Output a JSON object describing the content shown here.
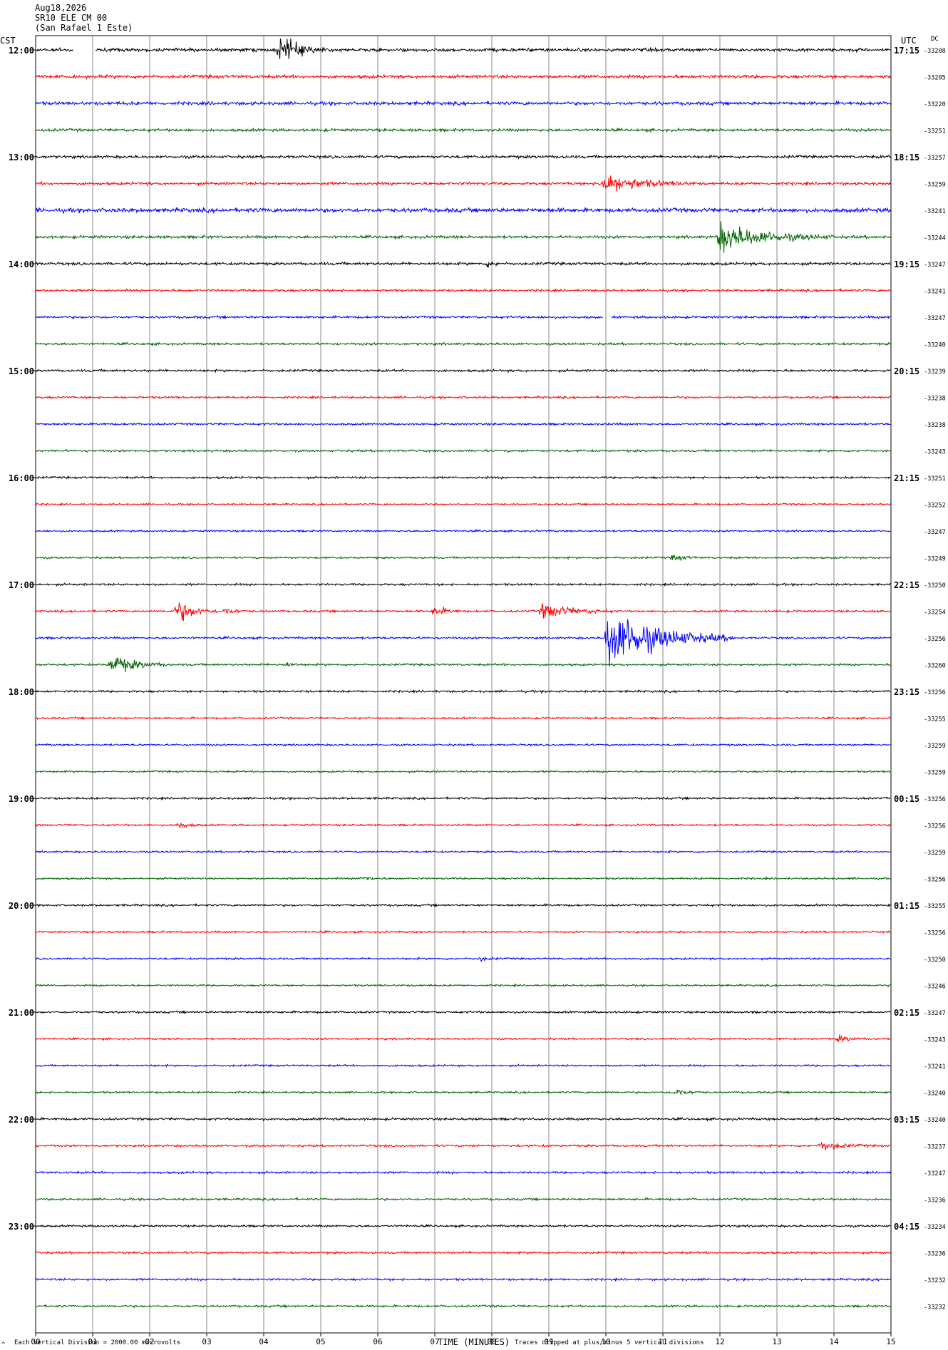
{
  "header": {
    "date": "Aug18,2026",
    "station": "SR10 ELE CM 00",
    "site": "(San Rafael 1 Este)"
  },
  "axes": {
    "left_tz": "CST",
    "right_tz": "UTC",
    "dc_label": "DC",
    "xlabel": "TIME (MINUTES)",
    "x_ticks": [
      "00",
      "01",
      "02",
      "03",
      "04",
      "05",
      "06",
      "07",
      "08",
      "09",
      "10",
      "11",
      "12",
      "13",
      "14",
      "15"
    ]
  },
  "footer": {
    "scale_note": "Each Vertical Division = 2000.00 microvolts",
    "clip_note": "Traces clipped at plus/minus 5 vertical divisions",
    "corner_mark": "^"
  },
  "colors": [
    "#000000",
    "#ff0000",
    "#0000ff",
    "#006400"
  ],
  "chart_data": {
    "type": "line",
    "description_kind": "helicorder",
    "minutes_per_line": 15,
    "x_range": [
      0,
      15
    ],
    "left_hour_labels": [
      "12:00",
      "13:00",
      "14:00",
      "15:00",
      "16:00",
      "17:00",
      "18:00",
      "19:00",
      "20:00",
      "21:00",
      "22:00",
      "23:00"
    ],
    "right_hour_labels": [
      "17:15",
      "18:15",
      "19:15",
      "20:15",
      "21:15",
      "22:15",
      "23:15",
      "00:15",
      "01:15",
      "02:15",
      "03:15",
      "04:15"
    ],
    "dc_offsets": [
      "-33208",
      "-33205",
      "-33220",
      "-33251",
      "-33257",
      "-33259",
      "-33241",
      "-33244",
      "-33247",
      "-33241",
      "-33247",
      "-33240",
      "-33239",
      "-33238",
      "-33238",
      "-33243",
      "-33251",
      "-33252",
      "-33247",
      "-33249",
      "-33250",
      "-33254",
      "-33256",
      "-33260",
      "-33256",
      "-33255",
      "-33259",
      "-33259",
      "-33256",
      "-33256",
      "-33259",
      "-33256",
      "-33255",
      "-33256",
      "-33250",
      "-33246",
      "-33247",
      "-33243",
      "-33241",
      "-33240",
      "-33240",
      "-33237",
      "-33247",
      "-33236",
      "-33234",
      "-33236",
      "-33232",
      "-33232"
    ],
    "noise_level": [
      0.7,
      0.7,
      0.7,
      0.6,
      0.6,
      0.6,
      0.9,
      0.6,
      0.6,
      0.5,
      0.5,
      0.5,
      0.5,
      0.45,
      0.45,
      0.45,
      0.45,
      0.4,
      0.4,
      0.4,
      0.45,
      0.45,
      0.45,
      0.45,
      0.45,
      0.4,
      0.4,
      0.4,
      0.45,
      0.4,
      0.4,
      0.4,
      0.45,
      0.4,
      0.4,
      0.4,
      0.45,
      0.4,
      0.4,
      0.4,
      0.5,
      0.45,
      0.45,
      0.45,
      0.45,
      0.45,
      0.45,
      0.45
    ],
    "events": [
      {
        "line": 0,
        "minute": 4.3,
        "amp": 14,
        "dur": 0.8
      },
      {
        "line": 5,
        "minute": 9.95,
        "amp": 10,
        "dur": 1.6
      },
      {
        "line": 7,
        "minute": 12.0,
        "amp": 14,
        "dur": 2.0
      },
      {
        "line": 8,
        "minute": 7.95,
        "amp": 3,
        "dur": 0.3
      },
      {
        "line": 19,
        "minute": 11.2,
        "amp": 3,
        "dur": 0.5
      },
      {
        "line": 21,
        "minute": 2.5,
        "amp": 11,
        "dur": 0.7
      },
      {
        "line": 21,
        "minute": 3.35,
        "amp": 3,
        "dur": 0.4
      },
      {
        "line": 21,
        "minute": 7.0,
        "amp": 5,
        "dur": 0.5
      },
      {
        "line": 21,
        "minute": 8.9,
        "amp": 8,
        "dur": 1.2
      },
      {
        "line": 22,
        "minute": 10.05,
        "amp": 30,
        "dur": 2.2
      },
      {
        "line": 23,
        "minute": 1.35,
        "amp": 10,
        "dur": 1.0
      },
      {
        "line": 23,
        "minute": 4.4,
        "amp": 2,
        "dur": 0.3
      },
      {
        "line": 29,
        "minute": 2.5,
        "amp": 3,
        "dur": 0.5
      },
      {
        "line": 31,
        "minute": 5.7,
        "amp": 2,
        "dur": 0.4
      },
      {
        "line": 34,
        "minute": 7.8,
        "amp": 2,
        "dur": 0.4
      },
      {
        "line": 37,
        "minute": 14.1,
        "amp": 3,
        "dur": 0.5
      },
      {
        "line": 39,
        "minute": 11.2,
        "amp": 4,
        "dur": 0.5
      },
      {
        "line": 41,
        "minute": 13.8,
        "amp": 5,
        "dur": 0.8
      }
    ],
    "gaps": [
      {
        "line": 0,
        "from": 0.65,
        "to": 1.05
      },
      {
        "line": 10,
        "from": 9.95,
        "to": 10.1
      }
    ]
  }
}
